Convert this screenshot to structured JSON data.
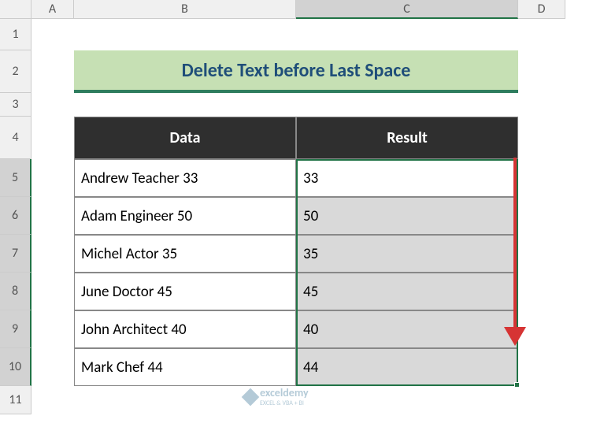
{
  "columns": [
    "A",
    "B",
    "C",
    "D"
  ],
  "rows": [
    "1",
    "2",
    "3",
    "4",
    "5",
    "6",
    "7",
    "8",
    "9",
    "10",
    "11"
  ],
  "title": "Delete Text before Last Space",
  "headers": {
    "data": "Data",
    "result": "Result"
  },
  "table": {
    "data": [
      "Andrew Teacher 33",
      "Adam Engineer 50",
      "Michel Actor 35",
      "June Doctor 45",
      "John Architect 40",
      "Mark Chef 44"
    ],
    "result": [
      "33",
      "50",
      "35",
      "45",
      "40",
      "44"
    ]
  },
  "watermark": "exceldemy",
  "watermark_sub": "EXCEL & VBA + BI",
  "selected_range": "C5:C10",
  "selected_rows": [
    5,
    6,
    7,
    8,
    9,
    10
  ],
  "selected_col": "C"
}
